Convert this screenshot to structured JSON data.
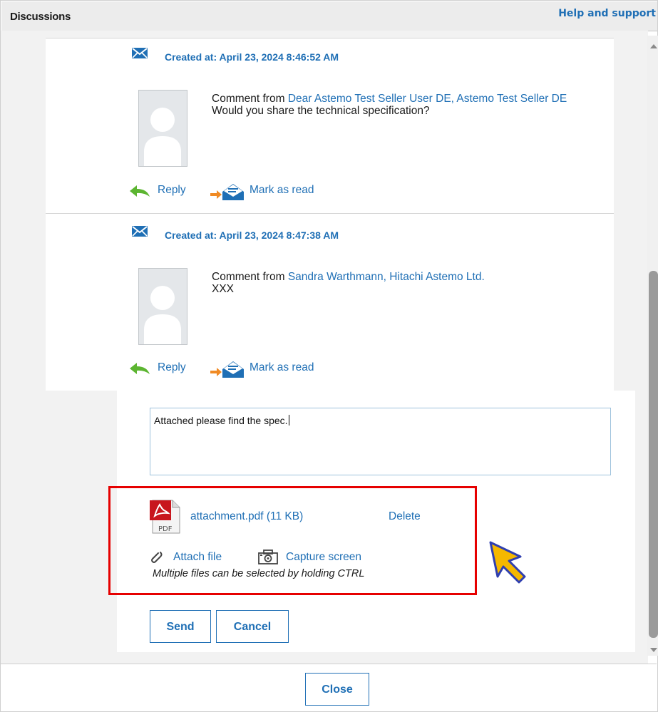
{
  "header": {
    "title": "Discussions",
    "help_label": "Help and support"
  },
  "messages": [
    {
      "created": "Created at: April 23, 2024 8:46:52 AM",
      "comment_prefix": "Comment from ",
      "author": "Dear Astemo Test Seller User DE, Astemo Test Seller DE",
      "body": "Would you share the technical specification?",
      "reply_label": "Reply",
      "mark_read_label": "Mark as read"
    },
    {
      "created": "Created at: April 23, 2024 8:47:38 AM",
      "comment_prefix": "Comment from ",
      "author": "Sandra Warthmann, Hitachi Astemo Ltd.",
      "body": "XXX",
      "reply_label": "Reply",
      "mark_read_label": "Mark as read"
    }
  ],
  "compose": {
    "text": "Attached please find the spec.",
    "attachment": {
      "name": "attachment.pdf (11 KB)",
      "delete_label": "Delete",
      "icon": "pdf-icon"
    },
    "attach_file_label": "Attach file",
    "capture_screen_label": "Capture screen",
    "hint": "Multiple files can be selected by holding CTRL",
    "send_label": "Send",
    "cancel_label": "Cancel"
  },
  "footer": {
    "close_label": "Close"
  },
  "colors": {
    "link": "#1f6fb5",
    "highlight": "#e60000",
    "cursor": "#f5b800"
  }
}
